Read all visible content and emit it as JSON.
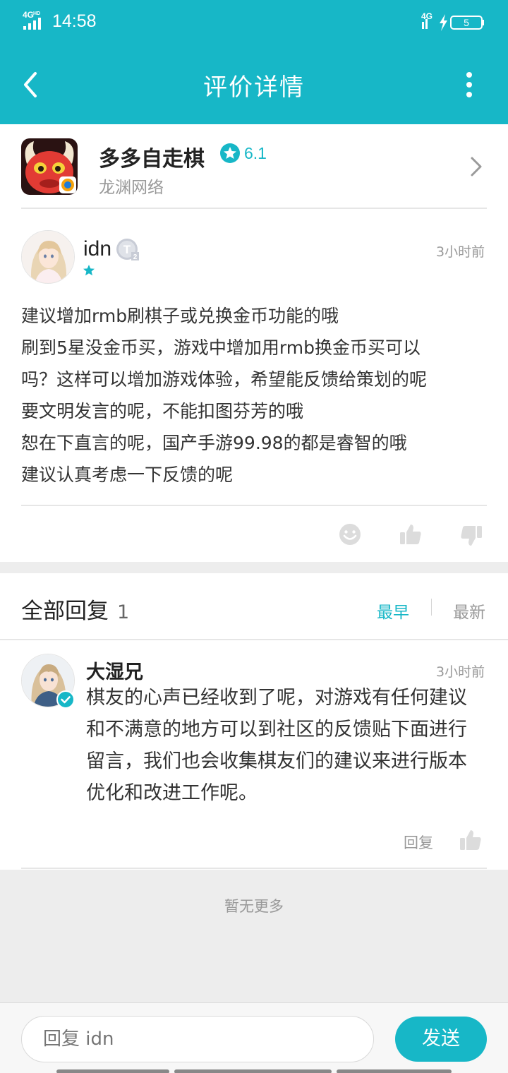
{
  "status_bar": {
    "time": "14:58",
    "network_left": "4G",
    "network_left_sup": "HD",
    "network_right": "4G",
    "battery": "5"
  },
  "nav": {
    "title": "评价详情",
    "back_icon": "back-arrow-icon",
    "more_icon": "more-vertical-icon"
  },
  "game": {
    "name": "多多自走棋",
    "rating": "6.1",
    "developer": "龙渊网络"
  },
  "review": {
    "user": "idn",
    "level_badge": "T",
    "level_sub": "2",
    "time": "3小时前",
    "lines": [
      "建议增加rmb刷棋子或兑换金币功能的哦",
      "刷到5星没金币买，游戏中增加用rmb换金币买可以",
      "吗？这样可以增加游戏体验，希望能反馈给策划的呢",
      "要文明发言的呢，不能扣图芬芳的哦",
      "恕在下直言的呢，国产手游99.98的都是睿智的哦",
      "建议认真考虑一下反馈的呢"
    ]
  },
  "replies": {
    "title": "全部回复",
    "count": "1",
    "sort_earliest": "最早",
    "sort_latest": "最新",
    "items": [
      {
        "name": "大湿兄",
        "time": "3小时前",
        "lines": [
          "棋友的心声已经收到了呢，对游戏有任何建议",
          "和不满意的地方可以到社区的反馈贴下面进行",
          "留言，我们也会收集棋友们的建议来进行版本",
          "优化和改进工作呢。"
        ],
        "reply_label": "回复"
      }
    ]
  },
  "no_more": "暂无更多",
  "composer": {
    "placeholder": "回复 idn",
    "send_label": "发送"
  },
  "colors": {
    "accent": "#17b7c7",
    "background": "#ededed",
    "text": "#333333",
    "muted": "#999999"
  }
}
